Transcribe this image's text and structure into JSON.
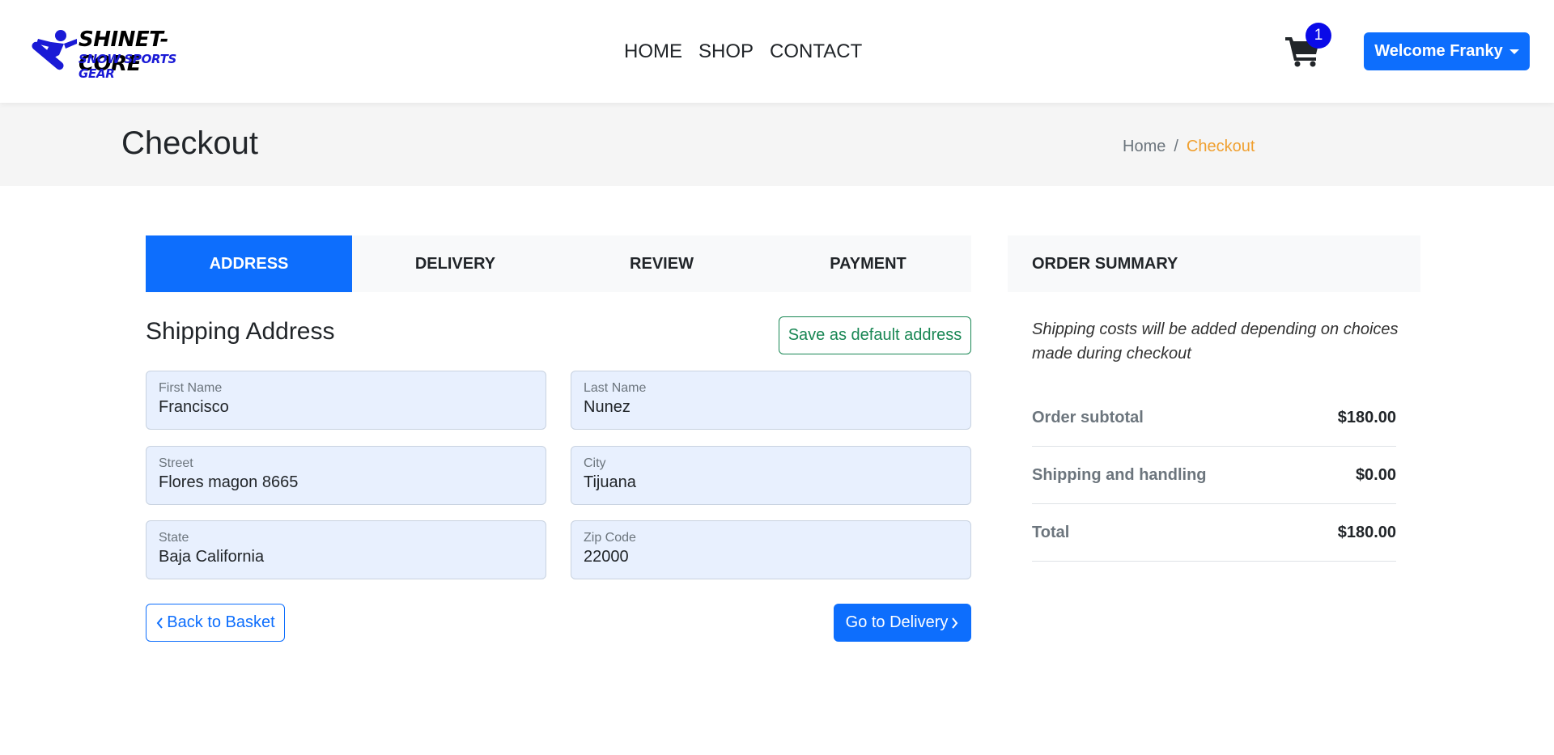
{
  "header": {
    "logo": {
      "line1": "SHINET-CORE",
      "line2": "SNOW SPORTS GEAR"
    },
    "nav": [
      "HOME",
      "SHOP",
      "CONTACT"
    ],
    "cart_count": "1",
    "user_menu_label": "Welcome Franky"
  },
  "page": {
    "title": "Checkout",
    "breadcrumb": {
      "home": "Home",
      "separator": "/",
      "current": "Checkout"
    }
  },
  "steps": [
    {
      "label": "ADDRESS",
      "active": true
    },
    {
      "label": "DELIVERY",
      "active": false
    },
    {
      "label": "REVIEW",
      "active": false
    },
    {
      "label": "PAYMENT",
      "active": false
    }
  ],
  "shipping": {
    "title": "Shipping Address",
    "save_default_label": "Save as default address",
    "fields": {
      "first_name": {
        "label": "First Name",
        "value": "Francisco"
      },
      "last_name": {
        "label": "Last Name",
        "value": "Nunez"
      },
      "street": {
        "label": "Street",
        "value": "Flores magon 8665"
      },
      "city": {
        "label": "City",
        "value": "Tijuana"
      },
      "state": {
        "label": "State",
        "value": "Baja California"
      },
      "zip": {
        "label": "Zip Code",
        "value": "22000"
      }
    },
    "back_label": "Back to Basket",
    "next_label": "Go to Delivery"
  },
  "summary": {
    "title": "ORDER SUMMARY",
    "note": "Shipping costs will be added depending on choices made during checkout",
    "rows": [
      {
        "label": "Order subtotal",
        "value": "$180.00"
      },
      {
        "label": "Shipping and handling",
        "value": "$0.00"
      },
      {
        "label": "Total",
        "value": "$180.00"
      }
    ]
  },
  "colors": {
    "primary": "#0d6efd",
    "success_outline": "#198754",
    "breadcrumb_active": "#f0a030",
    "badge": "#0a0ae8",
    "field_bg": "#e8f0fe"
  },
  "icons": [
    "snowboarder-logo-icon",
    "shopping-cart-icon",
    "caret-down-icon",
    "chevron-left-icon",
    "chevron-right-icon"
  ]
}
